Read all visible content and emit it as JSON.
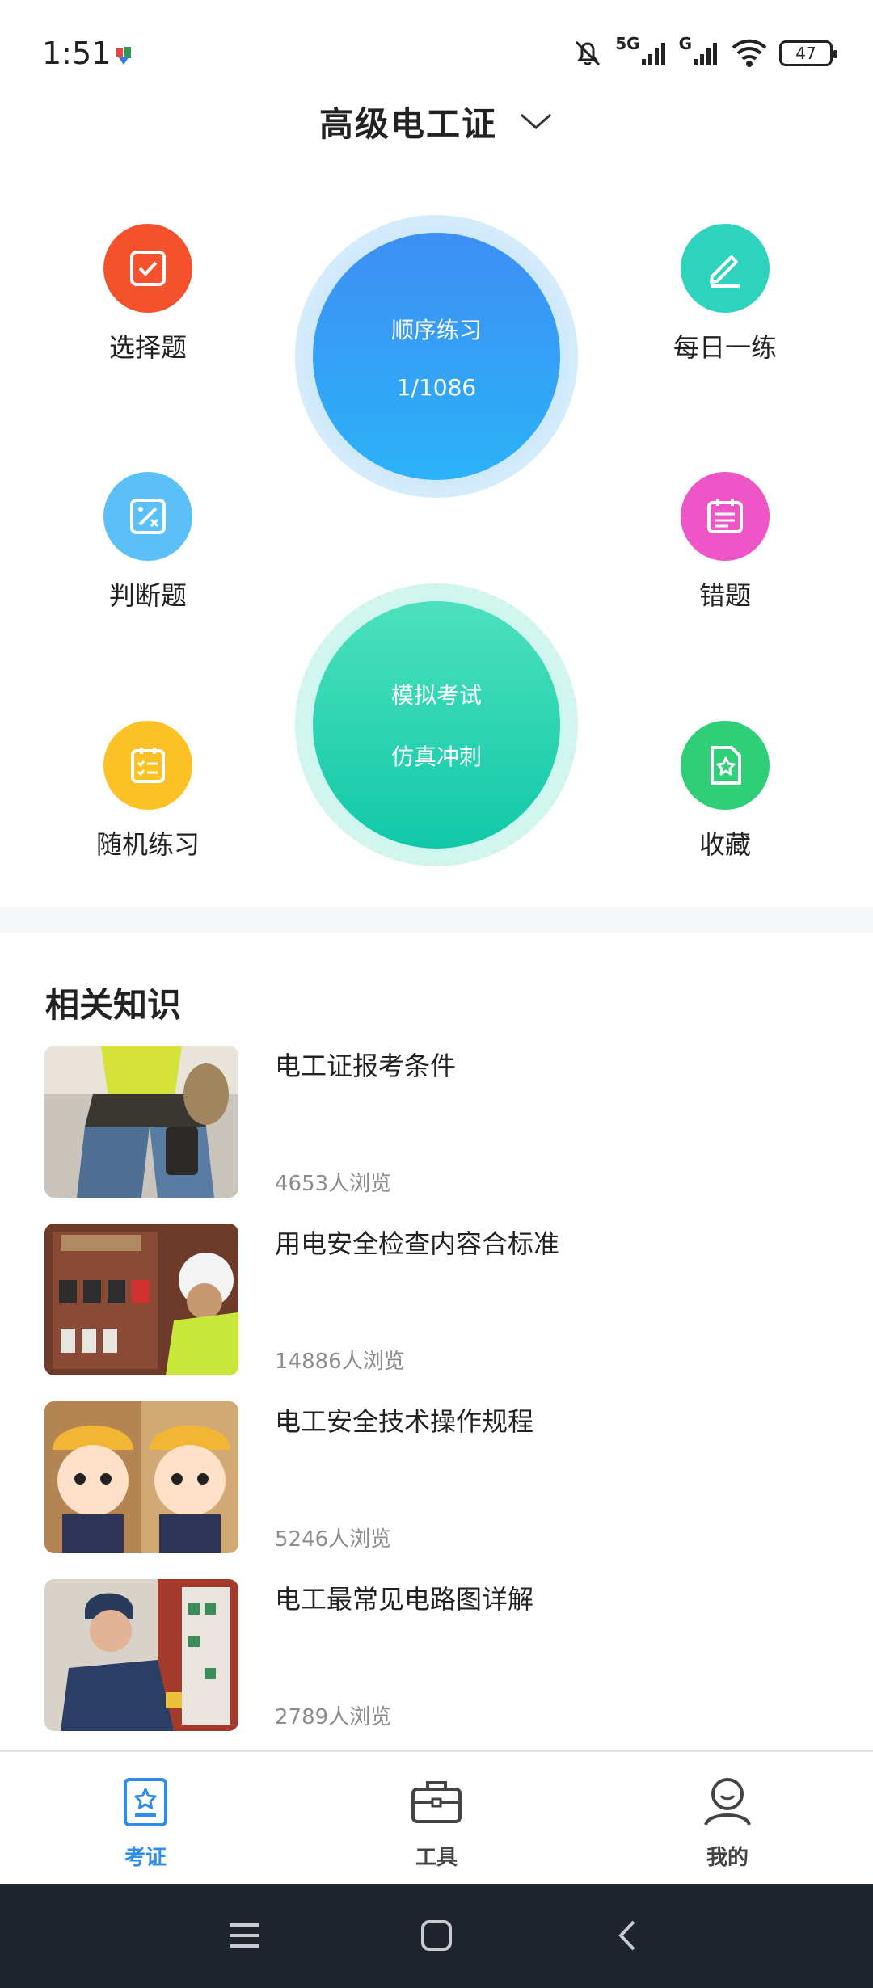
{
  "status": {
    "time": "1:51",
    "net1": "5G",
    "net2": "G",
    "battery": "47"
  },
  "header": {
    "title": "高级电工证",
    "dropdown_icon": "chevron-down-icon"
  },
  "features": {
    "choice": {
      "label": "选择题",
      "color": "#f4512c",
      "icon": "checkbox-icon"
    },
    "judge": {
      "label": "判断题",
      "color": "#5bc0f8",
      "icon": "percent-calc-icon"
    },
    "random": {
      "label": "随机练习",
      "color": "#fcc125",
      "icon": "checklist-icon"
    },
    "daily": {
      "label": "每日一练",
      "color": "#2ed3be",
      "icon": "pencil-icon"
    },
    "wrong": {
      "label": "错题",
      "color": "#ee56c8",
      "icon": "calendar-list-icon"
    },
    "favorite": {
      "label": "收藏",
      "color": "#2fcf78",
      "icon": "star-file-icon"
    }
  },
  "sequential": {
    "title": "顺序练习",
    "progress": "1/1086"
  },
  "mock_exam": {
    "title": "模拟考试",
    "subtitle": "仿真冲刺"
  },
  "knowledge": {
    "title": "相关知识",
    "articles": [
      {
        "title": "电工证报考条件",
        "views": "4653人浏览"
      },
      {
        "title": "用电安全检查内容合标准",
        "views": "14886人浏览"
      },
      {
        "title": "电工安全技术操作规程",
        "views": "5246人浏览"
      },
      {
        "title": "电工最常见电路图详解",
        "views": "2789人浏览"
      }
    ]
  },
  "nav": {
    "active_color": "#2f8ee6",
    "tabs": [
      {
        "label": "考证",
        "icon": "certificate-icon"
      },
      {
        "label": "工具",
        "icon": "toolbox-icon"
      },
      {
        "label": "我的",
        "icon": "profile-icon"
      }
    ]
  }
}
